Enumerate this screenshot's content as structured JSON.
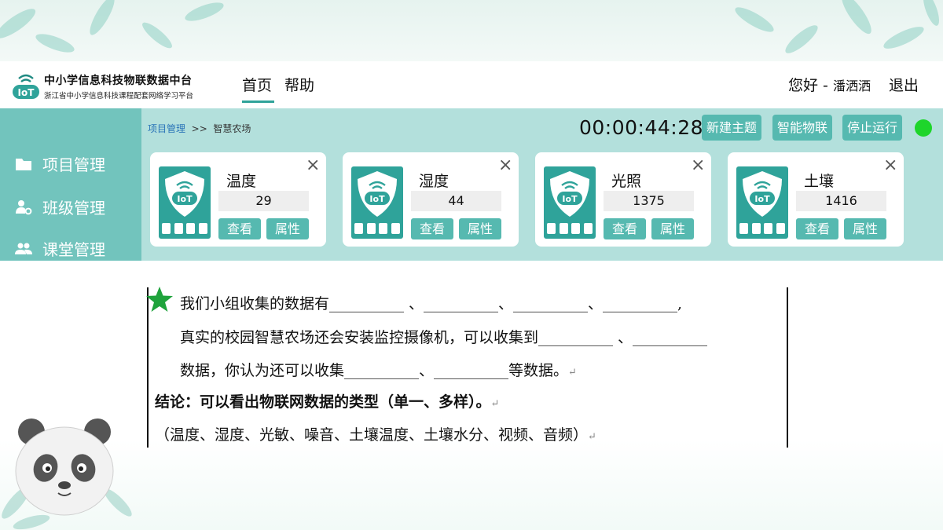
{
  "header": {
    "logo_text": "IoT",
    "title": "中小学信息科技物联数据中台",
    "subtitle": "浙江省中小学信息科技课程配套网络学习平台",
    "nav": [
      {
        "label": "首页"
      },
      {
        "label": "帮助"
      }
    ],
    "greeting": "您好 -",
    "user_name": "潘洒洒",
    "logout": "退出"
  },
  "sidebar": {
    "items": [
      {
        "label": "项目管理",
        "icon": "folder-icon"
      },
      {
        "label": "班级管理",
        "icon": "user-gear-icon"
      },
      {
        "label": "课堂管理",
        "icon": "users-icon"
      }
    ]
  },
  "breadcrumb": {
    "root": "项目管理",
    "separator": ">>",
    "current": "智慧农场"
  },
  "toolbar": {
    "timer": "00:00:44:28",
    "new_topic": "新建主题",
    "smart_iot": "智能物联",
    "stop": "停止运行",
    "status_color": "#1ed52b"
  },
  "cards": [
    {
      "name": "温度",
      "value": "29",
      "view": "查看",
      "props": "属性",
      "close": "×",
      "icon_text": "IoT"
    },
    {
      "name": "湿度",
      "value": "44",
      "view": "查看",
      "props": "属性",
      "close": "×",
      "icon_text": "IoT"
    },
    {
      "name": "光照",
      "value": "1375",
      "view": "查看",
      "props": "属性",
      "close": "×",
      "icon_text": "IoT"
    },
    {
      "name": "土壤",
      "value": "1416",
      "view": "查看",
      "props": "属性",
      "close": "×",
      "icon_text": "IoT"
    }
  ],
  "document": {
    "line1": "我们小组收集的数据有__________ 、__________、__________、__________,",
    "line2": "真实的校园智慧农场还会安装监控摄像机，可以收集到__________ 、__________",
    "line3": "数据，你认为还可以收集__________、__________等数据。",
    "conclusion": "结论：可以看出物联网数据的类型（单一、多样）。",
    "list": "（温度、湿度、光敏、噪音、土壤温度、土壤水分、视频、音频）",
    "para_mark": "↵"
  },
  "colors": {
    "accent": "#56b9b0",
    "sidebar": "#72c4bd",
    "panel": "#b3e0dc",
    "breadcrumb_link": "#2a74b8"
  }
}
